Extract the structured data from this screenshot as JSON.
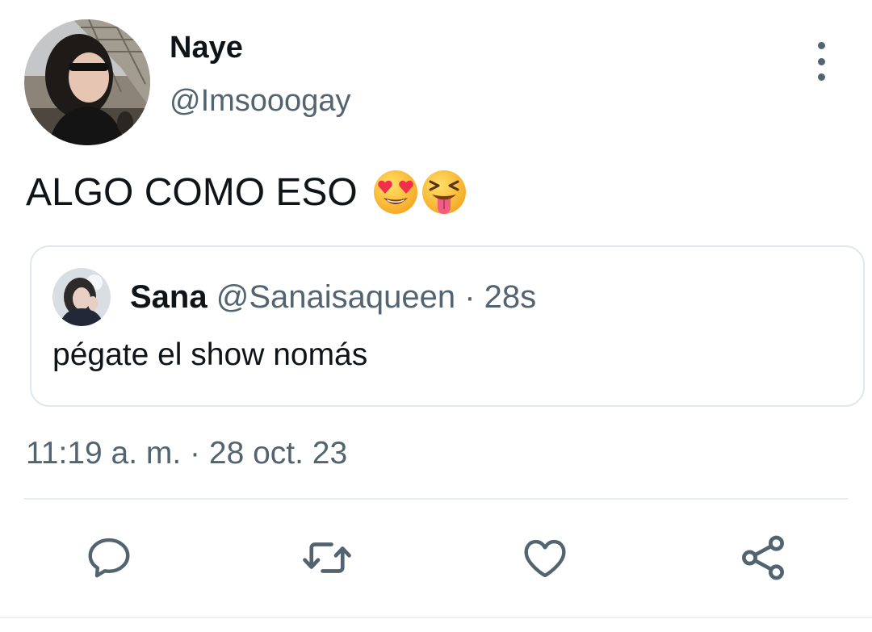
{
  "tweet": {
    "author": {
      "display_name": "Naye",
      "handle": "@Imsooogay"
    },
    "text": "ALGO COMO ESO",
    "emojis": [
      "smiling-face-with-heart-eyes",
      "squinting-face-with-tongue"
    ],
    "timestamp": "11:19 a. m. · 28 oct. 23"
  },
  "quoted_tweet": {
    "display_name": "Sana",
    "meta": "@Sanaisaqueen · 28s",
    "text": "pégate el show nomás"
  },
  "actions": [
    {
      "icon": "reply-icon"
    },
    {
      "icon": "retweet-icon"
    },
    {
      "icon": "like-icon"
    },
    {
      "icon": "share-icon"
    }
  ],
  "colors": {
    "primary_text": "#0f1419",
    "secondary_text": "#536471",
    "border": "#e1e8ed"
  }
}
